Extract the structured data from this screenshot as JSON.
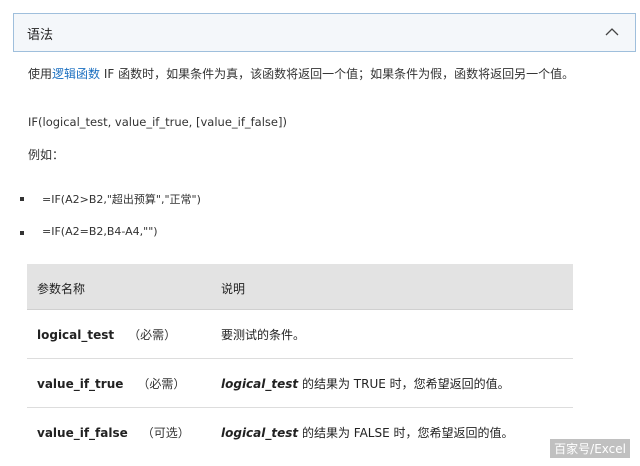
{
  "section": {
    "title": "语法",
    "collapse_icon": "chevron-up-icon"
  },
  "intro": {
    "prefix": "使用",
    "link": "逻辑函数",
    "suffix": " IF 函数时，如果条件为真，该函数将返回一个值；如果条件为假，函数将返回另一个值。"
  },
  "syntax": "IF(logical_test, value_if_true, [value_if_false])",
  "example_label": "例如：",
  "examples": [
    "=IF(A2>B2,\"超出预算\",\"正常\")",
    "=IF(A2=B2,B4-A4,\"\")"
  ],
  "table": {
    "headers": [
      "参数名称",
      "说明"
    ],
    "rows": [
      {
        "name": "logical_test",
        "req": "（必需）",
        "desc_em": "",
        "desc": "要测试的条件。"
      },
      {
        "name": "value_if_true",
        "req": "（必需）",
        "desc_em": "logical_test",
        "desc": " 的结果为 TRUE 时，您希望返回的值。"
      },
      {
        "name": "value_if_false",
        "req": "（可选）",
        "desc_em": "logical_test",
        "desc": " 的结果为 FALSE 时，您希望返回的值。"
      }
    ]
  },
  "watermark": "百家号/Excel"
}
